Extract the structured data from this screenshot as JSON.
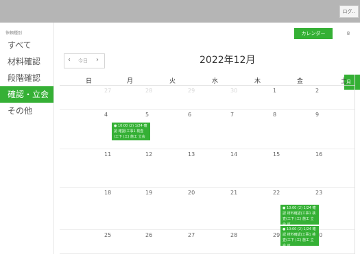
{
  "header": {
    "user_button": "ログ.."
  },
  "sidebar": {
    "heading": "依頼種別",
    "items": [
      {
        "label": "すべて"
      },
      {
        "label": "材料確認"
      },
      {
        "label": "段階確認"
      },
      {
        "label": "確認・立会"
      },
      {
        "label": "その他"
      }
    ],
    "active_index": 3
  },
  "toolbar": {
    "calendar_button": "カレンダー",
    "other_view_button": "8",
    "month_title": "2022年12月",
    "prev_icon": "chevron-left-icon",
    "next_icon": "chevron-right-icon",
    "today_label": "今日",
    "side_edge_label": "月"
  },
  "calendar": {
    "weekdays": [
      "日",
      "月",
      "火",
      "水",
      "木",
      "金",
      "土"
    ],
    "weeks": [
      {
        "days": [
          "27",
          "28",
          "29",
          "30",
          "1",
          "2",
          ""
        ],
        "dim": [
          true,
          true,
          true,
          true,
          false,
          false,
          false
        ]
      },
      {
        "days": [
          "4",
          "5",
          "6",
          "7",
          "8",
          "9",
          ""
        ],
        "dim": [
          false,
          false,
          false,
          false,
          false,
          false,
          false
        ]
      },
      {
        "days": [
          "11",
          "12",
          "13",
          "14",
          "15",
          "16",
          ""
        ],
        "dim": [
          false,
          false,
          false,
          false,
          false,
          false,
          false
        ]
      },
      {
        "days": [
          "18",
          "19",
          "20",
          "21",
          "22",
          "23",
          ""
        ],
        "dim": [
          false,
          false,
          false,
          false,
          false,
          false,
          false
        ]
      },
      {
        "days": [
          "25",
          "26",
          "27",
          "28",
          "29",
          "30",
          ""
        ],
        "dim": [
          false,
          false,
          false,
          false,
          false,
          false,
          false
        ]
      }
    ],
    "events": [
      {
        "text": "● 10:00 (2) 1/24 確認 確認(工事1 検査(工下 (工) 施工 立会",
        "week": 1,
        "day": 1
      },
      {
        "text": "● 10:00 (2) 1/24 確認 材料確認(工事1 検査(工下 (工) 施工 立会 可",
        "week": 3,
        "day": 5
      },
      {
        "text": "● 10:00 (2) 1/24 確認 材料確認(工事1 検査(工下 (工) 施工 立会 可",
        "week": 3,
        "day": 5
      }
    ]
  },
  "colors": {
    "accent": "#35b035",
    "topbar": "#b5b5b5"
  }
}
